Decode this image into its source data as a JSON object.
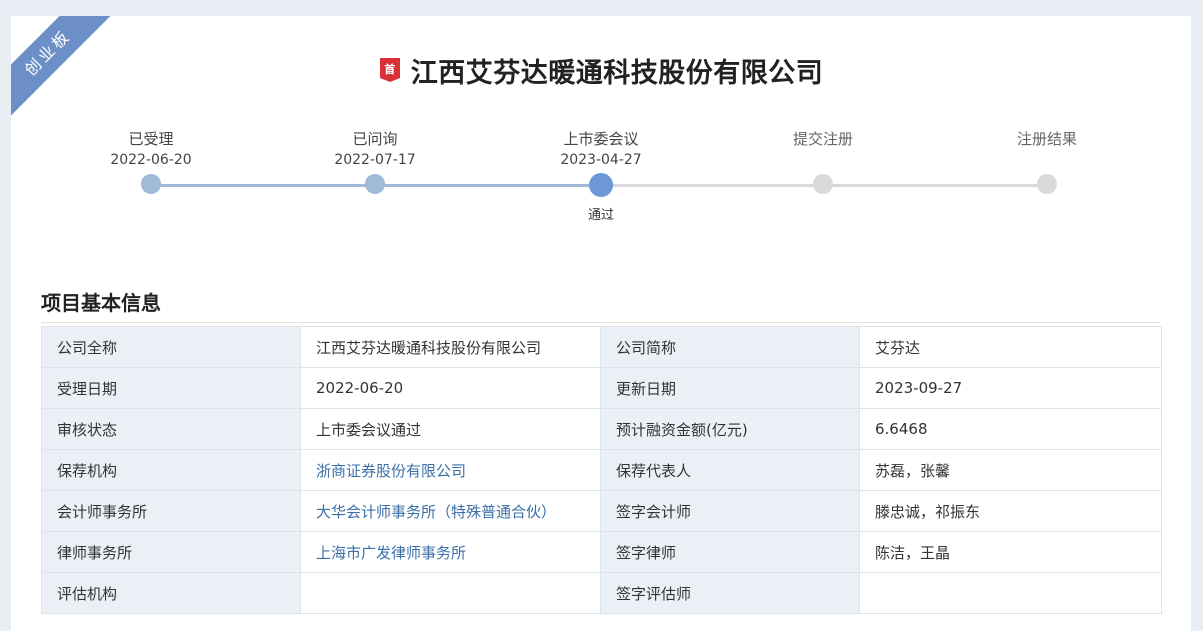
{
  "board_tag": "创业板",
  "company": {
    "badge": "首",
    "title": "江西艾芬达暖通科技股份有限公司"
  },
  "timeline": {
    "steps": [
      {
        "label": "已受理",
        "date": "2022-06-20",
        "status": "done"
      },
      {
        "label": "已问询",
        "date": "2022-07-17",
        "status": "done"
      },
      {
        "label": "上市委会议",
        "date": "2023-04-27",
        "status": "current",
        "result": "通过"
      },
      {
        "label": "提交注册",
        "date": "",
        "status": "todo"
      },
      {
        "label": "注册结果",
        "date": "",
        "status": "todo"
      }
    ]
  },
  "section": {
    "title": "项目基本信息"
  },
  "info_rows": [
    {
      "k1": "公司全称",
      "v1": "江西艾芬达暖通科技股份有限公司",
      "k2": "公司简称",
      "v2": "艾芬达"
    },
    {
      "k1": "受理日期",
      "v1": "2022-06-20",
      "k2": "更新日期",
      "v2": "2023-09-27"
    },
    {
      "k1": "审核状态",
      "v1": "上市委会议通过",
      "k2": "预计融资金额(亿元)",
      "v2": "6.6468"
    },
    {
      "k1": "保荐机构",
      "v1": "浙商证券股份有限公司",
      "k2": "保荐代表人",
      "v2": "苏磊，张馨"
    },
    {
      "k1": "会计师事务所",
      "v1": "大华会计师事务所（特殊普通合伙）",
      "k2": "签字会计师",
      "v2": "滕忠诚，祁振东"
    },
    {
      "k1": "律师事务所",
      "v1": "上海市广发律师事务所",
      "k2": "签字律师",
      "v2": "陈洁，王晶"
    },
    {
      "k1": "评估机构",
      "v1": "",
      "k2": "签字评估师",
      "v2": ""
    }
  ],
  "colors": {
    "accent": "#6d98d8",
    "done": "#9fb9d8",
    "todo": "#d9d9d9",
    "link": "#3b6fa8",
    "badge": "#d9303a",
    "ribbon": "#6d8fc7"
  }
}
